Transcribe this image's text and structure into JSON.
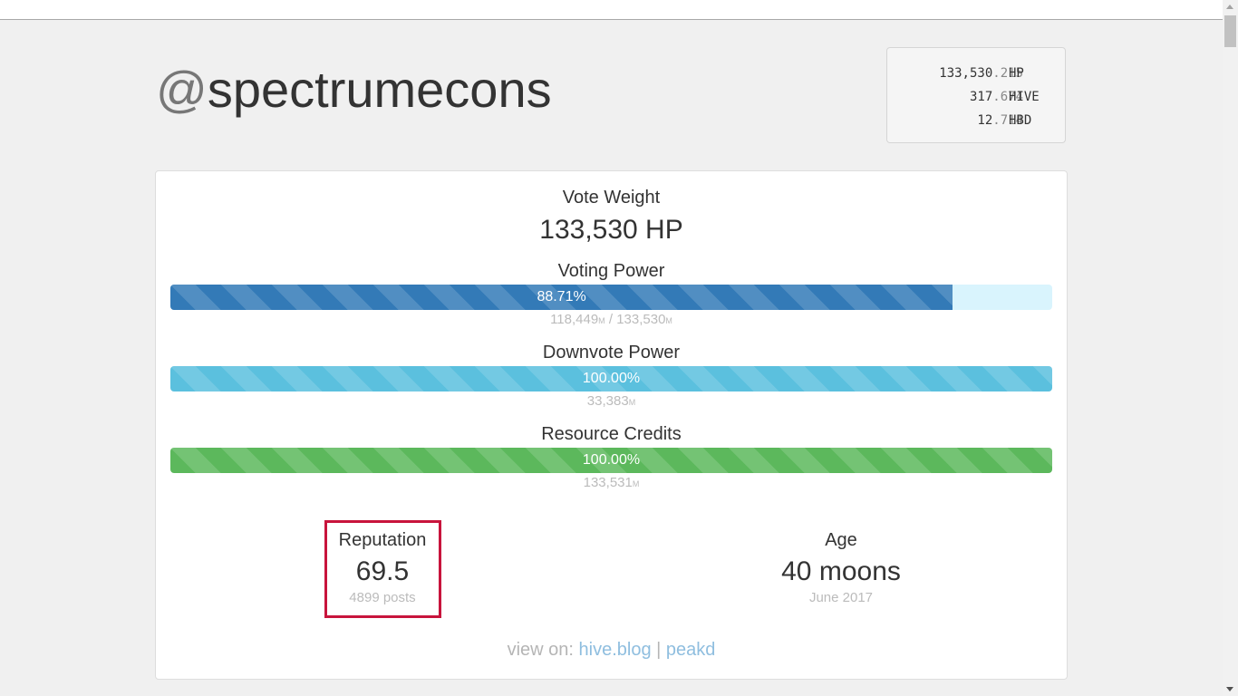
{
  "account": {
    "at": "@",
    "name": "spectrumecons"
  },
  "balances": [
    {
      "int": "133,530",
      "frac": ".215",
      "unit": "HP"
    },
    {
      "int": "317",
      "frac": ".674",
      "unit": "HIVE"
    },
    {
      "int": "12",
      "frac": ".714",
      "unit": "HBD"
    }
  ],
  "vote_weight": {
    "label": "Vote Weight",
    "value": "133,530 HP"
  },
  "voting_power": {
    "label": "Voting Power",
    "percent_text": "88.71%",
    "fraction": 0.8871,
    "current": "118,449",
    "max": "133,530",
    "unit": "M",
    "separator": " / ",
    "color": "#337ab7",
    "track_color": "#d9f4fd"
  },
  "downvote_power": {
    "label": "Downvote Power",
    "percent_text": "100.00%",
    "fraction": 1.0,
    "current": "33,383",
    "unit": "M",
    "color": "#5bc0de"
  },
  "resource_credits": {
    "label": "Resource Credits",
    "percent_text": "100.00%",
    "fraction": 1.0,
    "current": "133,531",
    "unit": "M",
    "color": "#5cb85c"
  },
  "reputation": {
    "label": "Reputation",
    "value": "69.5",
    "sub": "4899 posts",
    "highlight_color": "#c8143c"
  },
  "age": {
    "label": "Age",
    "value": "40 moons",
    "sub": "June 2017"
  },
  "view_on": {
    "prefix": "view on: ",
    "links": [
      "hive.blog",
      "peakd"
    ],
    "separator": " | "
  }
}
